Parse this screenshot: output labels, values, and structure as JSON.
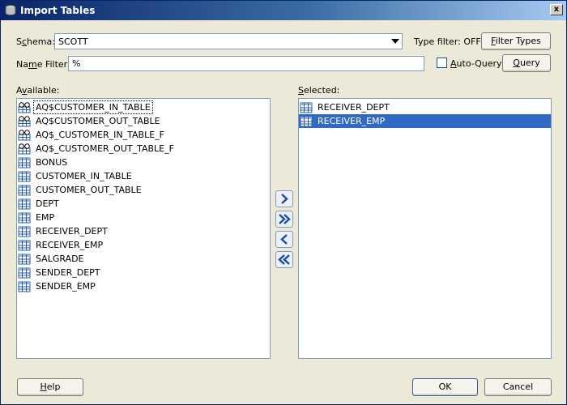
{
  "window": {
    "title": "Import Tables",
    "close_label": "x"
  },
  "schema": {
    "label_pre": "S",
    "label_u": "c",
    "label_post": "hema:",
    "value": "SCOTT"
  },
  "type_filter": {
    "label": "Type filter: OFF",
    "button_u": "F",
    "button_post": "ilter Types"
  },
  "name_filter": {
    "label_pre": "Na",
    "label_u": "m",
    "label_post": "e Filter:",
    "value": "%"
  },
  "auto_query": {
    "label_u": "A",
    "label_post": "uto-Query",
    "checked": false
  },
  "query_button": {
    "label_u": "Q",
    "label_post": "uery"
  },
  "available": {
    "label_pre": "A",
    "label_u": "v",
    "label_post": "ailable:",
    "items": [
      {
        "label": "AQ$CUSTOMER_IN_TABLE",
        "icon": "view-icon"
      },
      {
        "label": "AQ$CUSTOMER_OUT_TABLE",
        "icon": "view-icon"
      },
      {
        "label": "AQ$_CUSTOMER_IN_TABLE_F",
        "icon": "view-icon"
      },
      {
        "label": "AQ$_CUSTOMER_OUT_TABLE_F",
        "icon": "view-icon"
      },
      {
        "label": "BONUS",
        "icon": "table-icon"
      },
      {
        "label": "CUSTOMER_IN_TABLE",
        "icon": "table-icon"
      },
      {
        "label": "CUSTOMER_OUT_TABLE",
        "icon": "table-icon"
      },
      {
        "label": "DEPT",
        "icon": "table-icon"
      },
      {
        "label": "EMP",
        "icon": "table-icon"
      },
      {
        "label": "RECEIVER_DEPT",
        "icon": "table-icon"
      },
      {
        "label": "RECEIVER_EMP",
        "icon": "table-icon"
      },
      {
        "label": "SALGRADE",
        "icon": "table-icon"
      },
      {
        "label": "SENDER_DEPT",
        "icon": "table-icon"
      },
      {
        "label": "SENDER_EMP",
        "icon": "table-icon"
      }
    ]
  },
  "selected": {
    "label_u": "S",
    "label_post": "elected:",
    "items": [
      {
        "label": "RECEIVER_DEPT",
        "icon": "table-icon"
      },
      {
        "label": "RECEIVER_EMP",
        "icon": "table-icon"
      }
    ]
  },
  "move_buttons": [
    "move-right-icon",
    "move-all-right-icon",
    "move-left-icon",
    "move-all-left-icon"
  ],
  "footer": {
    "help_u": "H",
    "help_post": "elp",
    "ok_label": "OK",
    "cancel_label": "Cancel"
  },
  "colors": {
    "dialog_bg": "#ece9d8",
    "selection": "#316ac5",
    "title_start": "#0a246a"
  }
}
